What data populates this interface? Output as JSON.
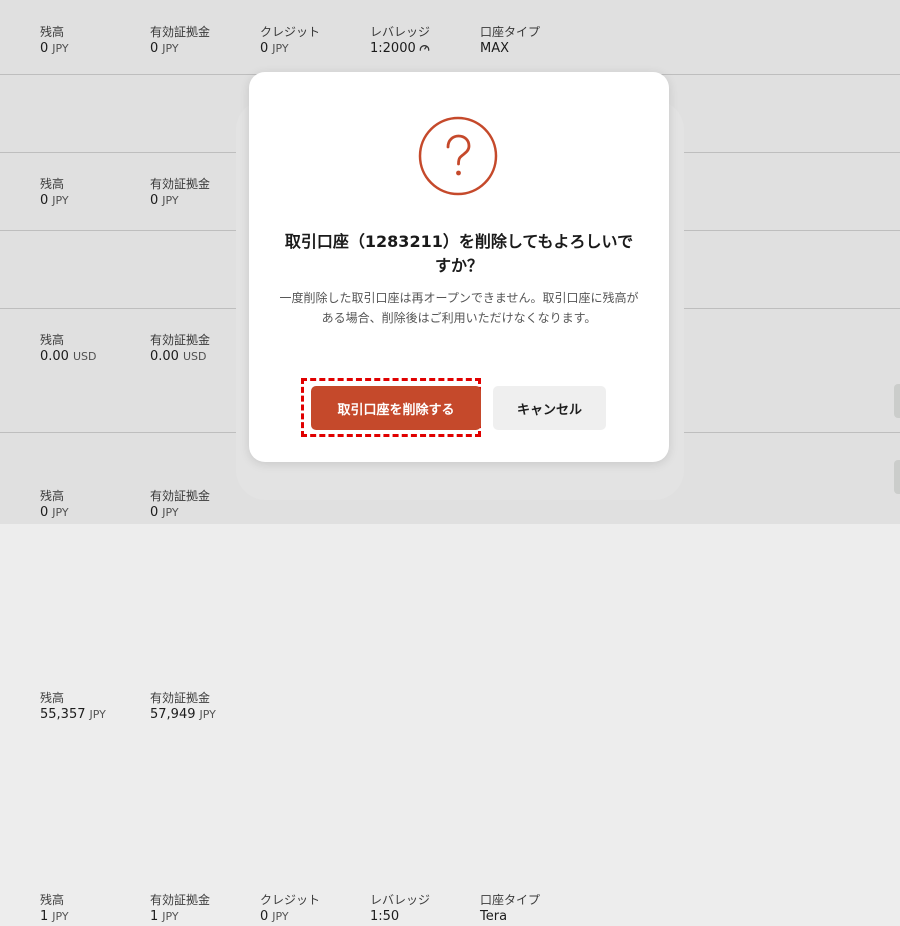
{
  "accounts": [
    {
      "balance": {
        "label": "残高",
        "value": "0",
        "unit": "JPY"
      },
      "margin": {
        "label": "有効証拠金",
        "value": "0",
        "unit": "JPY"
      },
      "credit": {
        "label": "クレジット",
        "value": "0",
        "unit": "JPY"
      },
      "leverage": {
        "label": "レバレッジ",
        "value": "1:2000"
      },
      "type": {
        "label": "口座タイプ",
        "value": "MAX"
      }
    },
    {
      "balance": {
        "label": "残高",
        "value": "0",
        "unit": "JPY"
      },
      "margin": {
        "label": "有効証拠金",
        "value": "0",
        "unit": "JPY"
      }
    },
    {
      "balance": {
        "label": "残高",
        "value": "0.00",
        "unit": "USD"
      },
      "margin": {
        "label": "有効証拠金",
        "value": "0.00",
        "unit": "USD"
      }
    },
    {
      "balance": {
        "label": "残高",
        "value": "0",
        "unit": "JPY"
      },
      "margin": {
        "label": "有効証拠金",
        "value": "0",
        "unit": "JPY"
      }
    },
    {
      "balance": {
        "label": "残高",
        "value": "55,357",
        "unit": "JPY"
      },
      "margin": {
        "label": "有効証拠金",
        "value": "57,949",
        "unit": "JPY"
      }
    },
    {
      "balance": {
        "label": "残高",
        "value": "1",
        "unit": "JPY"
      },
      "margin": {
        "label": "有効証拠金",
        "value": "1",
        "unit": "JPY"
      },
      "credit": {
        "label": "クレジット",
        "value": "0",
        "unit": "JPY"
      },
      "leverage": {
        "label": "レバレッジ",
        "value": "1:50"
      },
      "type": {
        "label": "口座タイプ",
        "value": "Tera"
      }
    }
  ],
  "dialog": {
    "icon": "question-icon",
    "title": "取引口座（1283211）を削除してもよろしいですか？",
    "message": "一度削除した取引口座は再オープンできません。取引口座に残高がある場合、削除後はご利用いただけなくなります。",
    "confirm_label": "取引口座を削除する",
    "cancel_label": "キャンセル"
  },
  "colors": {
    "accent": "#c5492b",
    "highlight": "#e00000",
    "cancel_bg": "#efefef",
    "page_bg": "#ededed"
  }
}
